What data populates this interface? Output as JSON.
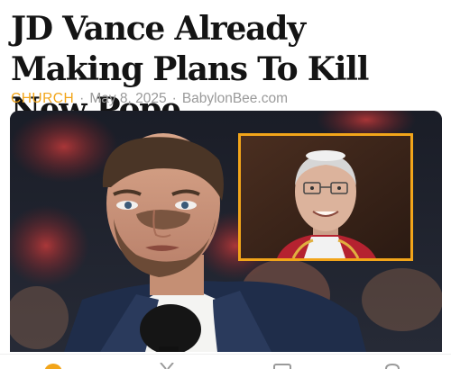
{
  "article": {
    "headline": "JD Vance Already Making Plans To Kill New Pope",
    "category": "CHURCH",
    "date": "May 8, 2025",
    "source": "BabylonBee.com",
    "separator": "·"
  },
  "colors": {
    "accent": "#f2a51a",
    "headline": "#141414",
    "meta": "#9a9a9a"
  },
  "bottom_bar": {
    "icons": [
      "circle-icon",
      "x-share-icon",
      "comment-icon",
      "bookmark-icon"
    ]
  }
}
